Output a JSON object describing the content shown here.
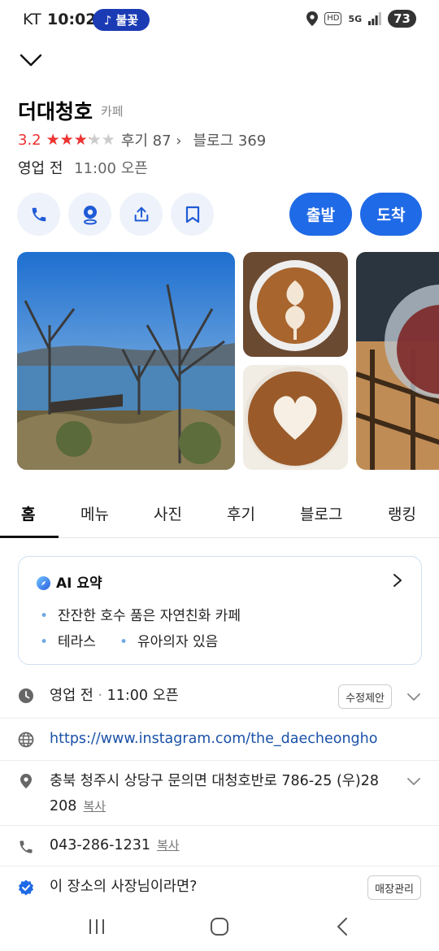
{
  "status_bar": {
    "carrier": "KT",
    "time": "10:02",
    "music_label": "불꽃",
    "hd_badge": "HD",
    "network": "5G",
    "battery": "73"
  },
  "place": {
    "name": "더대청호",
    "category": "카페",
    "rating": "3.2",
    "rating_fraction": 0.64,
    "reviews_label": "후기 87",
    "blog_label": "블로그 369",
    "status": "영업 전",
    "open_time": "11:00 오픈"
  },
  "actions": {
    "icons": [
      "phone-icon",
      "navigation-pin-icon",
      "share-icon",
      "bookmark-icon"
    ],
    "depart_label": "출발",
    "arrive_label": "도착"
  },
  "tabs": [
    "홈",
    "메뉴",
    "사진",
    "후기",
    "블로그",
    "랭킹"
  ],
  "ai_summary": {
    "title": "AI 요약",
    "bullets": [
      "잔잔한 호수 품은 자연친화 카페",
      "테라스",
      "유아의자 있음"
    ]
  },
  "info": {
    "hours_status": "영업 전",
    "hours_time": "11:00 오픈",
    "suggest_edit": "수정제안",
    "website": "https://www.instagram.com/the_daecheongho",
    "address_line1": "충북 청주시 상당구 문의면 대청호반로 786-25 (우)28",
    "address_line2": "208",
    "copy_label": "복사",
    "phone": "043-286-1231",
    "owner_prompt": "이 장소의 사장님이라면?",
    "manage_label": "매장관리"
  },
  "colors": {
    "accent_blue": "#1f6ae6",
    "star_red": "#e33333",
    "link_blue": "#1b51a8"
  }
}
